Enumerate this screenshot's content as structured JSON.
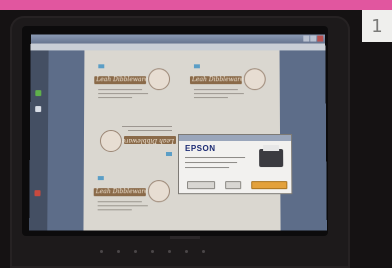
{
  "photo": {
    "corner_number": "1",
    "colors": {
      "top_band": "#e1569f",
      "badge_bg": "#efefed",
      "laptop_body": "#1d1a1b",
      "desktop": "#5d6d89",
      "document_page": "#dad7d0",
      "card_banner": "#8a6a49",
      "dialog_button_primary": "#e3a13b"
    }
  },
  "screen": {
    "card_text": "Leah Dibbleware",
    "dialog": {
      "brand": "EPSON"
    }
  }
}
